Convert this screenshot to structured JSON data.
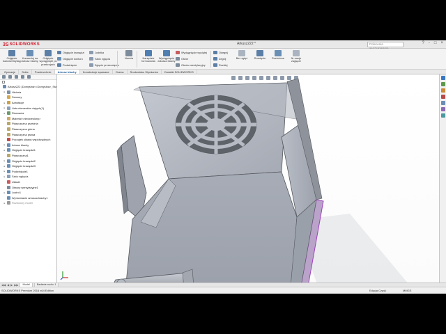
{
  "app": {
    "brand": "SOLIDWORKS",
    "document_title": "Arkusz222 *"
  },
  "search": {
    "placeholder": "Polecenia wyszukiwania"
  },
  "window_controls": [
    "?",
    "-",
    "□",
    "×"
  ],
  "ribbon": {
    "big_buttons": [
      {
        "label": "Odgięcie bazowe/Występ",
        "color": "#5b7fa6"
      },
      {
        "label": "Konwertuj na arkusz blachy",
        "color": "#6a8fb5"
      },
      {
        "label": "Odgięcie wyciągnięte po przekrojach",
        "color": "#5b7fa6"
      }
    ],
    "group1": [
      {
        "label": "Odgięcie krawędzi",
        "color": "#5b7fa6"
      },
      {
        "label": "Odgięcie konturu",
        "color": "#6a8fb5"
      },
      {
        "label": "Podwinięcie",
        "color": "#5b7fa6"
      }
    ],
    "group2": [
      {
        "label": "Jodełka",
        "color": "#8a9bb0"
      },
      {
        "label": "Szkic zgięcia",
        "color": "#8a9bb0"
      },
      {
        "label": "Zgięcie przesunięcia",
        "color": "#8a9bb0"
      }
    ],
    "corners_button": {
      "label": "Naroża",
      "color": "#7d8c9c"
    },
    "big_buttons2": [
      {
        "label": "Narzędzie formowania",
        "color": "#4f7eb0"
      },
      {
        "label": "Wyciągnięcie arkusza blachy",
        "color": "#4f7eb0"
      }
    ],
    "group3": [
      {
        "label": "Wyciągnięcie wyciętej",
        "color": "#c95c5c"
      },
      {
        "label": "Otwór",
        "color": "#7b8b9b"
      },
      {
        "label": "Otwórz wentylacyjny",
        "color": "#7b8b9b"
      }
    ],
    "group4": [
      {
        "label": "Odegnij",
        "color": "#5b7fa6"
      },
      {
        "label": "Zegnij",
        "color": "#5b7fa6"
      },
      {
        "label": "Rozkłej",
        "color": "#5b7fa6"
      }
    ],
    "big_buttons3": [
      {
        "label": "Bez zgięć",
        "color": "#aab4c0"
      },
      {
        "label": "Rozcięcie",
        "color": "#5b7fa6"
      },
      {
        "label": "Rozłożone",
        "color": "#6a8fb5"
      },
      {
        "label": "Nr swoje zagięcie",
        "color": "#aab4c0"
      }
    ]
  },
  "tabs": [
    "Operacje",
    "Szkic",
    "Powierzchnie",
    "Arkusz blachy",
    "Konstrukcje spawane",
    "Ocena",
    "Środowisko Wymiarów",
    "Dodatki SOLIDWORKS"
  ],
  "active_tab": 3,
  "feature_tree": [
    {
      "label": "Arkusz222 (Domyślna<<Domyślna>_Stan",
      "exp": "",
      "color": "#6b8ab0",
      "indent": 0
    },
    {
      "label": "Historia",
      "exp": "▸",
      "color": "#7c8fa4",
      "indent": 1
    },
    {
      "label": "Sensory",
      "exp": "",
      "color": "#d4a84a",
      "indent": 1
    },
    {
      "label": "Adnotacje",
      "exp": "▸",
      "color": "#c9a24b",
      "indent": 1
    },
    {
      "label": "Lista elementów ciętych(1)",
      "exp": "▸",
      "color": "#8aa0b8",
      "indent": 1
    },
    {
      "label": "Równania",
      "exp": "▸",
      "color": "#6a9a6a",
      "indent": 1
    },
    {
      "label": "Materiał <nieokreślony>",
      "exp": "",
      "color": "#cfa86a",
      "indent": 1
    },
    {
      "label": "Płaszczyzna przednia",
      "exp": "",
      "color": "#b9a86a",
      "indent": 1
    },
    {
      "label": "Płaszczyzna górna",
      "exp": "",
      "color": "#b9a86a",
      "indent": 1
    },
    {
      "label": "Płaszczyzna prawa",
      "exp": "",
      "color": "#b9a86a",
      "indent": 1
    },
    {
      "label": "Początek układu współrzędnych",
      "exp": "",
      "color": "#c44a4a",
      "indent": 1
    },
    {
      "label": "Arkusz blachy",
      "exp": "▸",
      "color": "#6a8fb5",
      "indent": 1
    },
    {
      "label": "Odgięcie krawędzi1",
      "exp": "▸",
      "color": "#6a8fb5",
      "indent": 1
    },
    {
      "label": "Płaszczyzna1",
      "exp": "",
      "color": "#b9a86a",
      "indent": 1
    },
    {
      "label": "Odgięcie krawędzi2",
      "exp": "▸",
      "color": "#6a8fb5",
      "indent": 1
    },
    {
      "label": "Odgięcie krawędzi3",
      "exp": "▸",
      "color": "#6a8fb5",
      "indent": 1
    },
    {
      "label": "Podwinięcie1",
      "exp": "▸",
      "color": "#6a8fb5",
      "indent": 1
    },
    {
      "label": "Szkic wgięcia",
      "exp": "▸",
      "color": "#8aa0b8",
      "indent": 1
    },
    {
      "label": "Układ1",
      "exp": "",
      "color": "#c95c5c",
      "indent": 1
    },
    {
      "label": "Otwory wentylacyjne1",
      "exp": "",
      "color": "#7b8b9b",
      "indent": 1
    },
    {
      "label": "Lustro1",
      "exp": "▸",
      "color": "#6a8fb5",
      "indent": 1
    },
    {
      "label": "Wyrównianie arkusza blachy1",
      "exp": "",
      "color": "#6a8fb5",
      "indent": 1
    },
    {
      "label": "Rozłożony model",
      "exp": "▸",
      "color": "#9a9a9a",
      "indent": 1,
      "grey": true
    }
  ],
  "bottom_tabs": [
    "Model",
    "Badanie ruchu 1"
  ],
  "status": {
    "left": "SOLIDWORKS Premium 2016 x64 Edition",
    "edit": "Edycja Część",
    "units": "MMGS"
  },
  "colors": {
    "model_face": "#aeb3bd",
    "model_dark": "#8f949e",
    "model_edge": "#55595f",
    "selected_edge": "#a040c0"
  }
}
